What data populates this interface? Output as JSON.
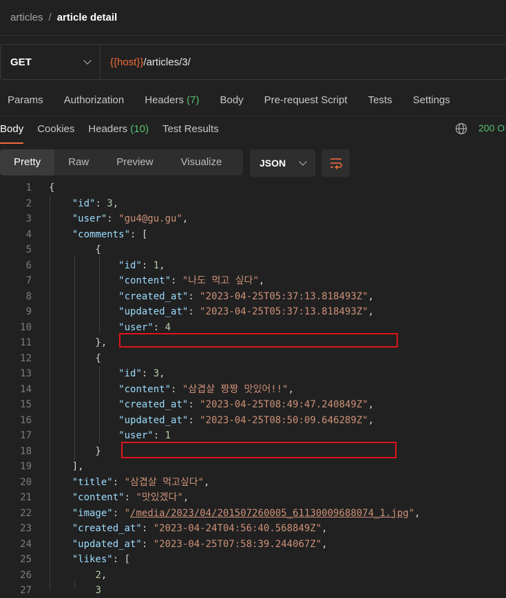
{
  "breadcrumb": {
    "parent": "articles",
    "separator": "/",
    "current": "article detail"
  },
  "request": {
    "method": "GET",
    "url_var": "{{host}}",
    "url_path": "/articles/3/"
  },
  "request_tabs": [
    {
      "label": "Params"
    },
    {
      "label": "Authorization"
    },
    {
      "label": "Headers",
      "count": "(7)"
    },
    {
      "label": "Body"
    },
    {
      "label": "Pre-request Script"
    },
    {
      "label": "Tests"
    },
    {
      "label": "Settings"
    }
  ],
  "response_tabs": [
    {
      "label": "Body"
    },
    {
      "label": "Cookies"
    },
    {
      "label": "Headers",
      "count": "(10)"
    },
    {
      "label": "Test Results"
    }
  ],
  "status": {
    "text": "200 O"
  },
  "view_modes": [
    "Pretty",
    "Raw",
    "Preview",
    "Visualize"
  ],
  "format": "JSON",
  "icons": {
    "globe": "globe-icon",
    "wrap": "wrap-lines-icon",
    "chevron": "chevron-down-icon"
  },
  "colors": {
    "accent": "#f26b3a",
    "success": "#57c270",
    "highlight_box": "#e0151b"
  },
  "code_lines": [
    {
      "n": "1",
      "t": [
        [
          "p",
          "{"
        ]
      ]
    },
    {
      "n": "2",
      "t": [
        [
          "p",
          "    "
        ],
        [
          "k",
          "\"id\""
        ],
        [
          "p",
          ": "
        ],
        [
          "n",
          "3"
        ],
        [
          "p",
          ","
        ]
      ]
    },
    {
      "n": "3",
      "t": [
        [
          "p",
          "    "
        ],
        [
          "k",
          "\"user\""
        ],
        [
          "p",
          ": "
        ],
        [
          "s",
          "\"gu4@gu.gu\""
        ],
        [
          "p",
          ","
        ]
      ]
    },
    {
      "n": "4",
      "t": [
        [
          "p",
          "    "
        ],
        [
          "k",
          "\"comments\""
        ],
        [
          "p",
          ": ["
        ]
      ]
    },
    {
      "n": "5",
      "t": [
        [
          "p",
          "        {"
        ]
      ]
    },
    {
      "n": "6",
      "t": [
        [
          "p",
          "            "
        ],
        [
          "k",
          "\"id\""
        ],
        [
          "p",
          ": "
        ],
        [
          "n",
          "1"
        ],
        [
          "p",
          ","
        ]
      ]
    },
    {
      "n": "7",
      "t": [
        [
          "p",
          "            "
        ],
        [
          "k",
          "\"content\""
        ],
        [
          "p",
          ": "
        ],
        [
          "s",
          "\"나도 먹고 싶다\""
        ],
        [
          "p",
          ","
        ]
      ]
    },
    {
      "n": "8",
      "t": [
        [
          "p",
          "            "
        ],
        [
          "k",
          "\"created_at\""
        ],
        [
          "p",
          ": "
        ],
        [
          "s",
          "\"2023-04-25T05:37:13.818493Z\""
        ],
        [
          "p",
          ","
        ]
      ]
    },
    {
      "n": "9",
      "t": [
        [
          "p",
          "            "
        ],
        [
          "k",
          "\"updated_at\""
        ],
        [
          "p",
          ": "
        ],
        [
          "s",
          "\"2023-04-25T05:37:13.818493Z\""
        ],
        [
          "p",
          ","
        ]
      ]
    },
    {
      "n": "10",
      "t": [
        [
          "p",
          "            "
        ],
        [
          "k",
          "\"user\""
        ],
        [
          "p",
          ": "
        ],
        [
          "n",
          "4"
        ]
      ]
    },
    {
      "n": "11",
      "t": [
        [
          "p",
          "        },"
        ]
      ]
    },
    {
      "n": "12",
      "t": [
        [
          "p",
          "        {"
        ]
      ]
    },
    {
      "n": "13",
      "t": [
        [
          "p",
          "            "
        ],
        [
          "k",
          "\"id\""
        ],
        [
          "p",
          ": "
        ],
        [
          "n",
          "3"
        ],
        [
          "p",
          ","
        ]
      ]
    },
    {
      "n": "14",
      "t": [
        [
          "p",
          "            "
        ],
        [
          "k",
          "\"content\""
        ],
        [
          "p",
          ": "
        ],
        [
          "s",
          "\"삼겹살 짱짱 맛있어!!\""
        ],
        [
          "p",
          ","
        ]
      ]
    },
    {
      "n": "15",
      "t": [
        [
          "p",
          "            "
        ],
        [
          "k",
          "\"created_at\""
        ],
        [
          "p",
          ": "
        ],
        [
          "s",
          "\"2023-04-25T08:49:47.240849Z\""
        ],
        [
          "p",
          ","
        ]
      ]
    },
    {
      "n": "16",
      "t": [
        [
          "p",
          "            "
        ],
        [
          "k",
          "\"updated_at\""
        ],
        [
          "p",
          ": "
        ],
        [
          "s",
          "\"2023-04-25T08:50:09.646289Z\""
        ],
        [
          "p",
          ","
        ]
      ]
    },
    {
      "n": "17",
      "t": [
        [
          "p",
          "            "
        ],
        [
          "k",
          "\"user\""
        ],
        [
          "p",
          ": "
        ],
        [
          "n",
          "1"
        ]
      ]
    },
    {
      "n": "18",
      "t": [
        [
          "p",
          "        }"
        ]
      ]
    },
    {
      "n": "19",
      "t": [
        [
          "p",
          "    ],"
        ]
      ]
    },
    {
      "n": "20",
      "t": [
        [
          "p",
          "    "
        ],
        [
          "k",
          "\"title\""
        ],
        [
          "p",
          ": "
        ],
        [
          "s",
          "\"삼겹살 먹고싶다\""
        ],
        [
          "p",
          ","
        ]
      ]
    },
    {
      "n": "21",
      "t": [
        [
          "p",
          "    "
        ],
        [
          "k",
          "\"content\""
        ],
        [
          "p",
          ": "
        ],
        [
          "s",
          "\"맛있겠다\""
        ],
        [
          "p",
          ","
        ]
      ]
    },
    {
      "n": "22",
      "t": [
        [
          "p",
          "    "
        ],
        [
          "k",
          "\"image\""
        ],
        [
          "p",
          ": "
        ],
        [
          "s",
          "\""
        ],
        [
          "sl",
          "/media/2023/04/201507260005_61130009688074_1.jpg"
        ],
        [
          "s",
          "\""
        ],
        [
          "p",
          ","
        ]
      ]
    },
    {
      "n": "23",
      "t": [
        [
          "p",
          "    "
        ],
        [
          "k",
          "\"created_at\""
        ],
        [
          "p",
          ": "
        ],
        [
          "s",
          "\"2023-04-24T04:56:40.568849Z\""
        ],
        [
          "p",
          ","
        ]
      ]
    },
    {
      "n": "24",
      "t": [
        [
          "p",
          "    "
        ],
        [
          "k",
          "\"updated_at\""
        ],
        [
          "p",
          ": "
        ],
        [
          "s",
          "\"2023-04-25T07:58:39.244067Z\""
        ],
        [
          "p",
          ","
        ]
      ]
    },
    {
      "n": "25",
      "t": [
        [
          "p",
          "    "
        ],
        [
          "k",
          "\"likes\""
        ],
        [
          "p",
          ": ["
        ]
      ]
    },
    {
      "n": "26",
      "t": [
        [
          "p",
          "        "
        ],
        [
          "n",
          "2"
        ],
        [
          "p",
          ","
        ]
      ]
    },
    {
      "n": "27",
      "t": [
        [
          "p",
          "        "
        ],
        [
          "n",
          "3"
        ]
      ]
    }
  ]
}
